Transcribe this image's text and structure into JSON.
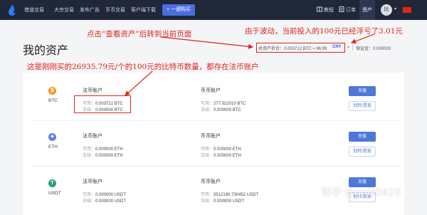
{
  "nav": {
    "items": [
      "借道交易",
      "大宗交易",
      "发布广告",
      "币币交易",
      "客户端下载"
    ],
    "buy_button": "+ 一键购买",
    "right": {
      "tutorial": "教程",
      "orders": "订单",
      "assets": "资产",
      "avatar": "比"
    }
  },
  "page": {
    "title": "我的资产",
    "summary_label_value": "总资产折合：0.003712 BTC ≈ 96.99",
    "summary_currency": "CNY",
    "summary_caret": "▾",
    "margin": "保证金：0.000000"
  },
  "annotations": {
    "top_left": "点击“查看资产”后转到当前页面",
    "top_right": "由于波动，当前投入的100元已经浮亏了3.01元",
    "middle": "这是刚刚买的26935.79元/个的100元的比特币数量，都存在法币账户"
  },
  "assets": [
    {
      "symbol": "BTC",
      "icon": "bitcoin-icon",
      "icon_color": "#f7931a",
      "icon_glyph": "₿",
      "fiat_title": "法币账户",
      "fiat_available_label": "可用：",
      "fiat_available": "0.003712 BTC",
      "fiat_frozen_label": "冻结：",
      "fiat_frozen": "0.000000 BTC",
      "spot_title": "币币账户",
      "spot_available_label": "可用：",
      "spot_available": "277.022010 BTC",
      "spot_frozen_label": "冻结：",
      "spot_frozen": "0.000000 BTC",
      "primary_button": "充值",
      "secondary_button": "划转/提现"
    },
    {
      "symbol": "ETH",
      "icon": "ethereum-icon",
      "icon_color": "#627eea",
      "icon_glyph": "◆",
      "fiat_title": "法币账户",
      "fiat_available_label": "可用：",
      "fiat_available": "0.000000 ETH",
      "fiat_frozen_label": "冻结：",
      "fiat_frozen": "0.000000 ETH",
      "spot_title": "币币账户",
      "spot_available_label": "可用：",
      "spot_available": "0.000000 ETH",
      "spot_frozen_label": "冻结：",
      "spot_frozen": "0.000000 ETH",
      "primary_button": "充值",
      "secondary_button": "划转/提现"
    },
    {
      "symbol": "USDT",
      "icon": "tether-icon",
      "icon_color": "#26a17b",
      "icon_glyph": "T",
      "fiat_title": "法币账户",
      "fiat_available_label": "可用：",
      "fiat_available": "0.000000 USDT",
      "fiat_frozen_label": "冻结：",
      "fiat_frozen": "0.000000 USDT",
      "spot_title": "币币账户",
      "spot_available_label": "可用：",
      "spot_available": "5512190.730452 USDT",
      "spot_frozen_label": "冻结：",
      "spot_frozen": "0.000000 USDT",
      "primary_button": "充值",
      "secondary_button": "划转/提现"
    }
  ],
  "watermark": "知乎 @gnis0428",
  "colors": {
    "nav_bg": "#1f2738",
    "accent": "#4e77d9",
    "annotation": "#e0241b"
  }
}
